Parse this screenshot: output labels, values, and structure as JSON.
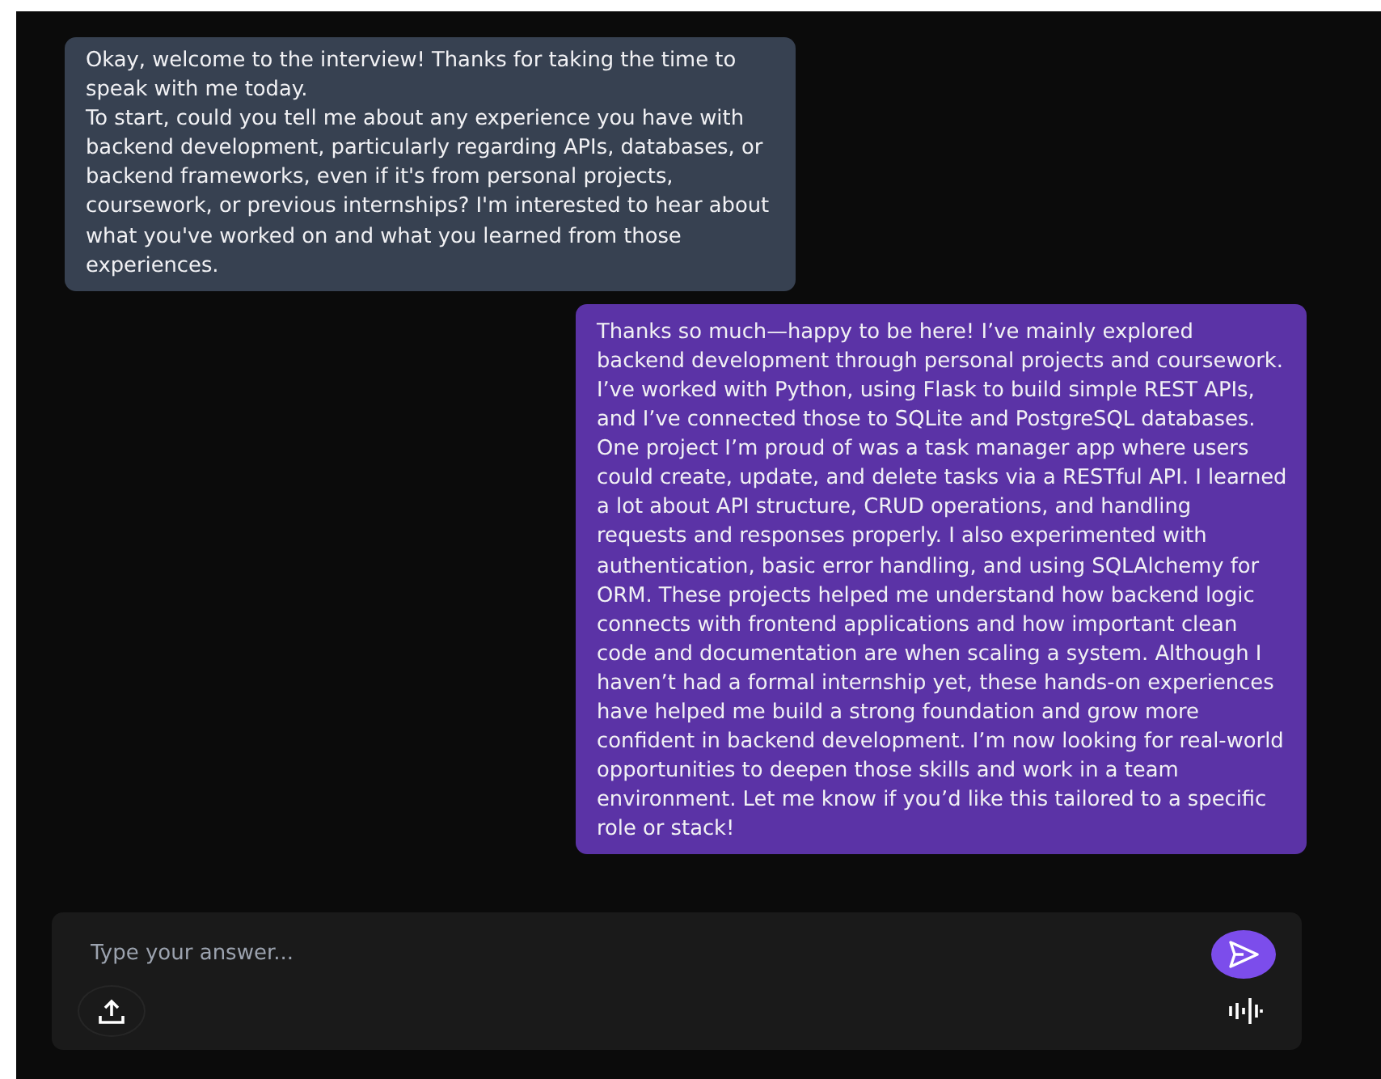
{
  "messages": [
    {
      "kind": "interviewer",
      "paragraphs": [
        "Okay, welcome to the interview! Thanks for taking the time to speak with me today.",
        "To start, could you tell me about any experience you have with backend development, particularly regarding APIs, databases, or backend frameworks, even if it's from personal projects, coursework, or previous internships? I'm interested to hear about what you've worked on and what you learned from those experiences."
      ]
    },
    {
      "kind": "candidate",
      "paragraphs": [
        "Thanks so much—happy to be here! I’ve mainly explored backend development through personal projects and coursework. I’ve worked with Python, using Flask to build simple REST APIs, and I’ve connected those to SQLite and PostgreSQL databases. One project I’m proud of was a task manager app where users could create, update, and delete tasks via a RESTful API. I learned a lot about API structure, CRUD operations, and handling requests and responses properly. I also experimented with authentication, basic error handling, and using SQLAlchemy for ORM. These projects helped me understand how backend logic connects with frontend applications and how important clean code and documentation are when scaling a system. Although I haven’t had a formal internship yet, these hands-on experiences have helped me build a strong foundation and grow more confident in backend development. I’m now looking for real-world opportunities to deepen those skills and work in a team environment. Let me know if you’d like this tailored to a specific role or stack!"
      ]
    }
  ],
  "composer": {
    "placeholder": "Type your answer..."
  }
}
